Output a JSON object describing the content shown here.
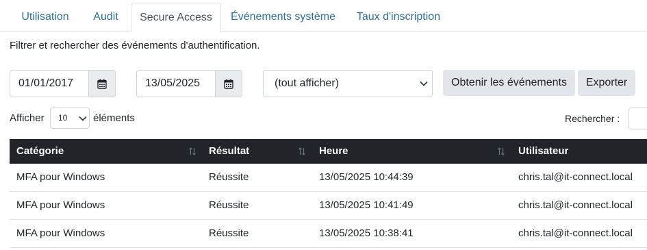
{
  "tabs": [
    {
      "label": "Utilisation"
    },
    {
      "label": "Audit"
    },
    {
      "label": "Secure Access"
    },
    {
      "label": "Événements système"
    },
    {
      "label": "Taux d'inscription"
    }
  ],
  "active_tab": "Secure Access",
  "description": "Filtrer et rechercher des événements d'authentification.",
  "filters": {
    "start_date": "01/01/2017",
    "end_date": "13/05/2025",
    "event_filter": "(tout afficher)",
    "get_events_label": "Obtenir les événements",
    "export_label": "Exporter"
  },
  "page_length": {
    "prefix": "Afficher",
    "value": "10",
    "suffix": "éléments"
  },
  "search": {
    "label": "Rechercher :"
  },
  "table": {
    "columns": [
      "Catégorie",
      "Résultat",
      "Heure",
      "Utilisateur"
    ],
    "rows": [
      [
        "MFA pour Windows",
        "Réussite",
        "13/05/2025 10:44:39",
        "chris.tal@it-connect.local"
      ],
      [
        "MFA pour Windows",
        "Réussite",
        "13/05/2025 10:41:49",
        "chris.tal@it-connect.local"
      ],
      [
        "MFA pour Windows",
        "Réussite",
        "13/05/2025 10:38:41",
        "chris.tal@it-connect.local"
      ]
    ]
  },
  "colors": {
    "tab_link": "#2f6f9e",
    "header_bg": "#212529",
    "button_bg": "#e2e5e9",
    "border": "#ced4da"
  }
}
